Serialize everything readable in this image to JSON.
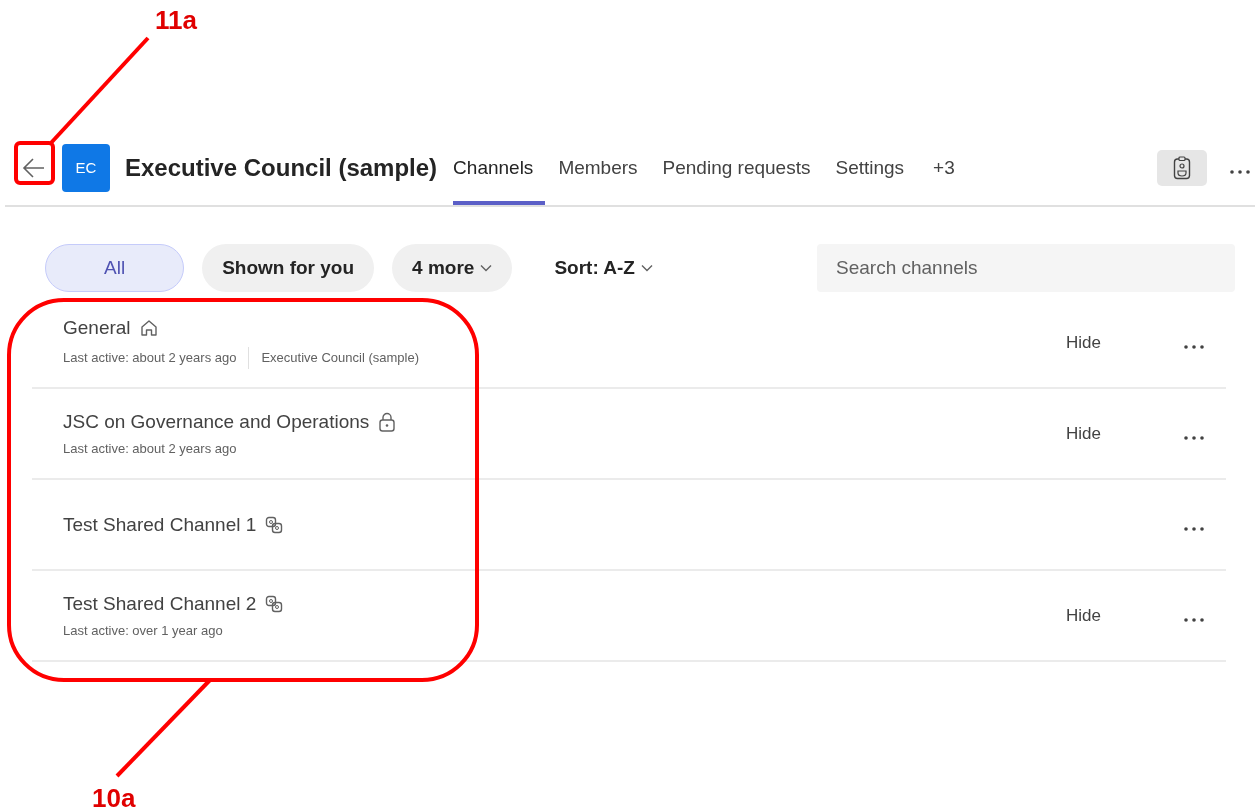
{
  "header": {
    "team_initials": "EC",
    "team_name": "Executive Council (sample)",
    "tabs": [
      {
        "label": "Channels",
        "selected": true
      },
      {
        "label": "Members",
        "selected": false
      },
      {
        "label": "Pending requests",
        "selected": false
      },
      {
        "label": "Settings",
        "selected": false
      }
    ],
    "overflow": "+3"
  },
  "filters": [
    {
      "label": "All",
      "kind": "chip",
      "selected": true
    },
    {
      "label": "Shown for you",
      "kind": "chip",
      "selected": false
    },
    {
      "label": "4 more",
      "kind": "dropdown",
      "selected": false
    },
    {
      "label": "Sort: A-Z",
      "kind": "sort",
      "selected": false
    }
  ],
  "search": {
    "placeholder": "Search channels"
  },
  "channels": [
    {
      "name": "General",
      "kind": "home",
      "last_active": "Last active: about 2 years ago",
      "team": "Executive Council (sample)",
      "hide": "Hide"
    },
    {
      "name": "JSC on Governance and Operations",
      "kind": "private",
      "last_active": "Last active: about 2 years ago",
      "hide": "Hide"
    },
    {
      "name": "Test Shared Channel 1",
      "kind": "shared"
    },
    {
      "name": "Test Shared Channel 2",
      "kind": "shared",
      "last_active": "Last active: over 1 year ago",
      "hide": "Hide"
    }
  ],
  "annotations": [
    {
      "label": "11a",
      "kind": "box"
    },
    {
      "label": "10a",
      "kind": "rounded"
    }
  ]
}
